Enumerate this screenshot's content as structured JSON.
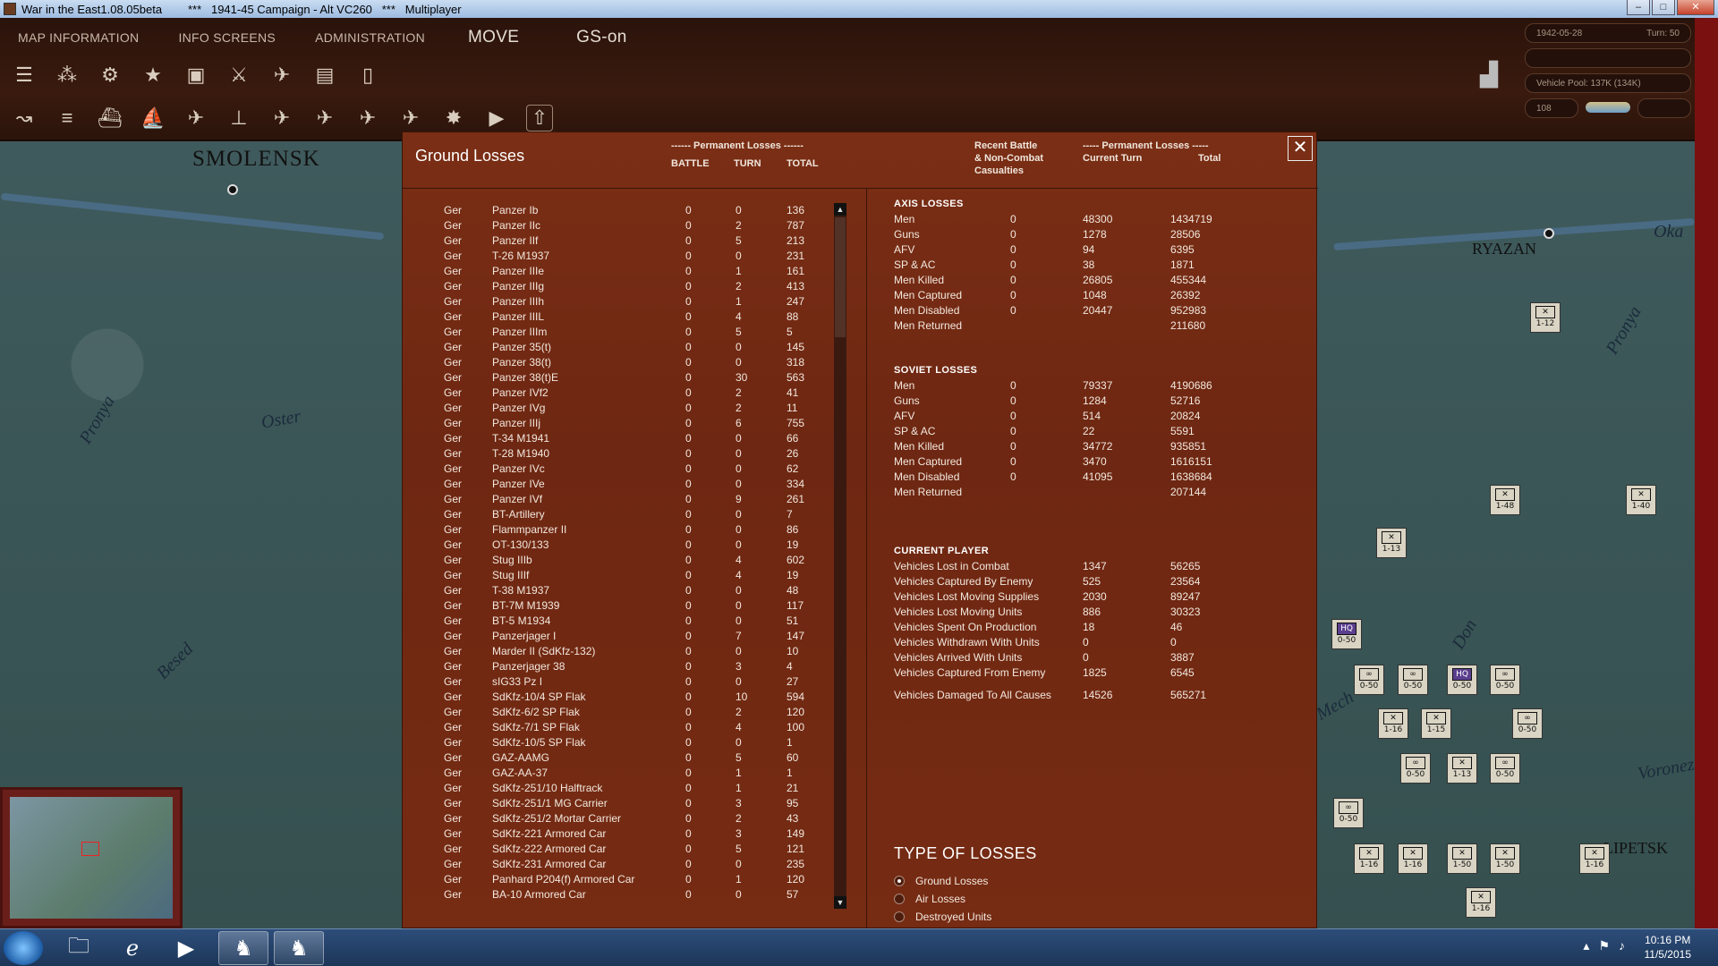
{
  "window": {
    "title": "War in the East1.08.05beta        ***   1941-45 Campaign - Alt VC260   ***   Multiplayer",
    "min": "–",
    "max": "□",
    "close": "✕"
  },
  "menu": {
    "items": [
      "MAP INFORMATION",
      "INFO SCREENS",
      "ADMINISTRATION"
    ],
    "move": "MOVE",
    "gs": "GS-on"
  },
  "toolbar_row2_icons": [
    "F1",
    "F2",
    "F3",
    "F4",
    "F5",
    "F6",
    "F7",
    "F8",
    "F9",
    "F10",
    "F11",
    "F12"
  ],
  "right_panel": {
    "date": "1942-05-28",
    "turn": "Turn: 50",
    "vehicle_pool": "Vehicle Pool: 137K (134K)",
    "value108": "108"
  },
  "map": {
    "cities": [
      "SMOLENSK",
      "RYAZAN",
      "LIPETSK"
    ],
    "rivers": [
      "Oster",
      "Pronya",
      "Besed",
      "Oka",
      "Pronya",
      "Don",
      "Voronezh",
      "Mech"
    ]
  },
  "dialog": {
    "title": "Ground Losses",
    "close": "✕",
    "perm_losses_header": "------ Permanent Losses ------",
    "col_battle": "BATTLE",
    "col_turn": "TURN",
    "col_total": "TOTAL",
    "recent_header_1": "Recent Battle",
    "recent_header_2": "& Non-Combat",
    "recent_header_3": "Casualties",
    "perm_losses_header2": "----- Permanent Losses -----",
    "col_current_turn": "Current Turn",
    "col_total2": "Total",
    "rows": [
      [
        "Ger",
        "Panzer Ib",
        "0",
        "0",
        "136"
      ],
      [
        "Ger",
        "Panzer IIc",
        "0",
        "2",
        "787"
      ],
      [
        "Ger",
        "Panzer IIf",
        "0",
        "5",
        "213"
      ],
      [
        "Ger",
        "T-26 M1937",
        "0",
        "0",
        "231"
      ],
      [
        "Ger",
        "Panzer IIIe",
        "0",
        "1",
        "161"
      ],
      [
        "Ger",
        "Panzer IIIg",
        "0",
        "2",
        "413"
      ],
      [
        "Ger",
        "Panzer IIIh",
        "0",
        "1",
        "247"
      ],
      [
        "Ger",
        "Panzer IIIL",
        "0",
        "4",
        "88"
      ],
      [
        "Ger",
        "Panzer IIIm",
        "0",
        "5",
        "5"
      ],
      [
        "Ger",
        "Panzer 35(t)",
        "0",
        "0",
        "145"
      ],
      [
        "Ger",
        "Panzer 38(t)",
        "0",
        "0",
        "318"
      ],
      [
        "Ger",
        "Panzer 38(t)E",
        "0",
        "30",
        "563"
      ],
      [
        "Ger",
        "Panzer IVf2",
        "0",
        "2",
        "41"
      ],
      [
        "Ger",
        "Panzer IVg",
        "0",
        "2",
        "11"
      ],
      [
        "Ger",
        "Panzer IIIj",
        "0",
        "6",
        "755"
      ],
      [
        "Ger",
        "T-34 M1941",
        "0",
        "0",
        "66"
      ],
      [
        "Ger",
        "T-28 M1940",
        "0",
        "0",
        "26"
      ],
      [
        "Ger",
        "Panzer IVc",
        "0",
        "0",
        "62"
      ],
      [
        "Ger",
        "Panzer IVe",
        "0",
        "0",
        "334"
      ],
      [
        "Ger",
        "Panzer IVf",
        "0",
        "9",
        "261"
      ],
      [
        "Ger",
        "BT-Artillery",
        "0",
        "0",
        "7"
      ],
      [
        "Ger",
        "Flammpanzer II",
        "0",
        "0",
        "86"
      ],
      [
        "Ger",
        "OT-130/133",
        "0",
        "0",
        "19"
      ],
      [
        "Ger",
        "Stug IIIb",
        "0",
        "4",
        "602"
      ],
      [
        "Ger",
        "Stug IIIf",
        "0",
        "4",
        "19"
      ],
      [
        "Ger",
        "T-38 M1937",
        "0",
        "0",
        "48"
      ],
      [
        "Ger",
        "BT-7M M1939",
        "0",
        "0",
        "117"
      ],
      [
        "Ger",
        "BT-5 M1934",
        "0",
        "0",
        "51"
      ],
      [
        "Ger",
        "Panzerjager I",
        "0",
        "7",
        "147"
      ],
      [
        "Ger",
        "Marder II (SdKfz-132)",
        "0",
        "0",
        "10"
      ],
      [
        "Ger",
        "Panzerjager 38",
        "0",
        "3",
        "4"
      ],
      [
        "Ger",
        "sIG33 Pz I",
        "0",
        "0",
        "27"
      ],
      [
        "Ger",
        "SdKfz-10/4 SP Flak",
        "0",
        "10",
        "594"
      ],
      [
        "Ger",
        "SdKfz-6/2 SP Flak",
        "0",
        "2",
        "120"
      ],
      [
        "Ger",
        "SdKfz-7/1 SP Flak",
        "0",
        "4",
        "100"
      ],
      [
        "Ger",
        "SdKfz-10/5 SP Flak",
        "0",
        "0",
        "1"
      ],
      [
        "Ger",
        "GAZ-AAMG",
        "0",
        "5",
        "60"
      ],
      [
        "Ger",
        "GAZ-AA-37",
        "0",
        "1",
        "1"
      ],
      [
        "Ger",
        "SdKfz-251/10 Halftrack",
        "0",
        "1",
        "21"
      ],
      [
        "Ger",
        "SdKfz-251/1 MG Carrier",
        "0",
        "3",
        "95"
      ],
      [
        "Ger",
        "SdKfz-251/2 Mortar Carrier",
        "0",
        "2",
        "43"
      ],
      [
        "Ger",
        "SdKfz-221 Armored Car",
        "0",
        "3",
        "149"
      ],
      [
        "Ger",
        "SdKfz-222 Armored Car",
        "0",
        "5",
        "121"
      ],
      [
        "Ger",
        "SdKfz-231 Armored Car",
        "0",
        "0",
        "235"
      ],
      [
        "Ger",
        "Panhard P204(f) Armored Car",
        "0",
        "1",
        "120"
      ],
      [
        "Ger",
        "BA-10 Armored Car",
        "0",
        "0",
        "57"
      ]
    ],
    "axis": {
      "title": "AXIS LOSSES",
      "rows": [
        [
          "Men",
          "0",
          "48300",
          "1434719"
        ],
        [
          "Guns",
          "0",
          "1278",
          "28506"
        ],
        [
          "AFV",
          "0",
          "94",
          "6395"
        ],
        [
          "SP & AC",
          "0",
          "38",
          "1871"
        ],
        [
          "Men Killed",
          "0",
          "26805",
          "455344"
        ],
        [
          "Men Captured",
          "0",
          "1048",
          "26392"
        ],
        [
          "Men Disabled",
          "0",
          "20447",
          "952983"
        ],
        [
          "Men Returned",
          "",
          "",
          "211680"
        ]
      ]
    },
    "soviet": {
      "title": "SOVIET LOSSES",
      "rows": [
        [
          "Men",
          "0",
          "79337",
          "4190686"
        ],
        [
          "Guns",
          "0",
          "1284",
          "52716"
        ],
        [
          "AFV",
          "0",
          "514",
          "20824"
        ],
        [
          "SP & AC",
          "0",
          "22",
          "5591"
        ],
        [
          "Men Killed",
          "0",
          "34772",
          "935851"
        ],
        [
          "Men Captured",
          "0",
          "3470",
          "1616151"
        ],
        [
          "Men Disabled",
          "0",
          "41095",
          "1638684"
        ],
        [
          "Men Returned",
          "",
          "",
          "207144"
        ]
      ]
    },
    "current": {
      "title": "CURRENT PLAYER",
      "rows": [
        [
          "Vehicles Lost in Combat",
          "1347",
          "56265"
        ],
        [
          "Vehicles Captured By Enemy",
          "525",
          "23564"
        ],
        [
          "Vehicles Lost Moving Supplies",
          "2030",
          "89247"
        ],
        [
          "Vehicles Lost Moving Units",
          "886",
          "30323"
        ],
        [
          "Vehicles Spent On Production",
          "18",
          "46"
        ],
        [
          "Vehicles Withdrawn With Units",
          "0",
          "0"
        ],
        [
          "Vehicles Arrived With Units",
          "0",
          "3887"
        ],
        [
          "Vehicles Captured From Enemy",
          "1825",
          "6545"
        ]
      ],
      "damaged": [
        "Vehicles Damaged To All Causes",
        "14526",
        "565271"
      ]
    },
    "type_of_losses": {
      "title": "TYPE OF LOSSES",
      "options": [
        "Ground Losses",
        "Air Losses",
        "Destroyed Units"
      ],
      "selected": 0
    }
  },
  "taskbar": {
    "time": "10:16 PM",
    "date": "11/5/2015"
  }
}
